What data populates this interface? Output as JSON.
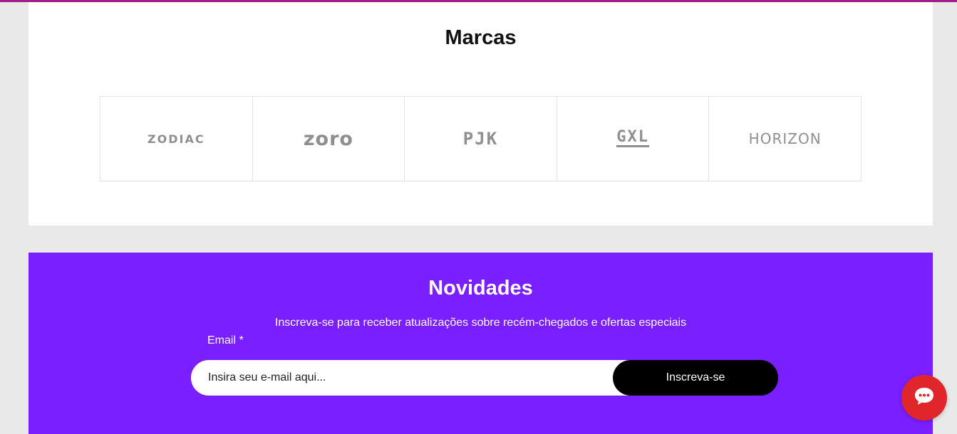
{
  "brands": {
    "title": "Marcas",
    "items": [
      {
        "name": "ZODIAC"
      },
      {
        "name": "zoro"
      },
      {
        "name": "PJK"
      },
      {
        "name": "GXL"
      },
      {
        "name": "HORIZON"
      }
    ]
  },
  "newsletter": {
    "title": "Novidades",
    "subtitle": "Inscreva-se para receber atualizações sobre recém-chegados e ofertas especiais",
    "email_label": "Email *",
    "email_placeholder": "Insira seu e-mail aqui...",
    "email_value": "",
    "subscribe_label": "Inscreva-se",
    "background_color": "#7a1fff"
  },
  "chat": {
    "icon": "chat-bubble-icon",
    "color": "#e0262b"
  }
}
